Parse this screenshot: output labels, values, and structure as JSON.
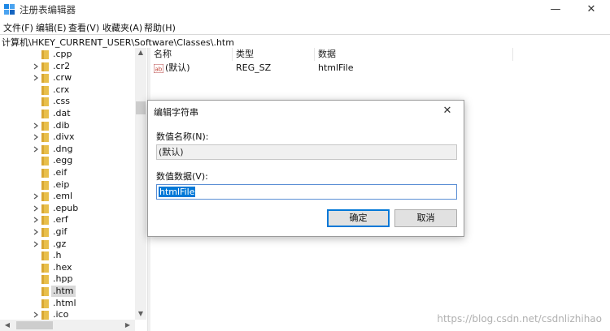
{
  "window": {
    "title": "注册表编辑器",
    "minimize": "—",
    "close": "✕"
  },
  "menu": [
    "文件(F)",
    "编辑(E)",
    "查看(V)",
    "收藏夹(A)",
    "帮助(H)"
  ],
  "address": "计算机\\HKEY_CURRENT_USER\\Software\\Classes\\.htm",
  "tree": [
    {
      "label": ".cpp",
      "expandable": false
    },
    {
      "label": ".cr2",
      "expandable": true
    },
    {
      "label": ".crw",
      "expandable": true
    },
    {
      "label": ".crx",
      "expandable": false
    },
    {
      "label": ".css",
      "expandable": false
    },
    {
      "label": ".dat",
      "expandable": false
    },
    {
      "label": ".dib",
      "expandable": true
    },
    {
      "label": ".divx",
      "expandable": true
    },
    {
      "label": ".dng",
      "expandable": true
    },
    {
      "label": ".egg",
      "expandable": false
    },
    {
      "label": ".eif",
      "expandable": false
    },
    {
      "label": ".eip",
      "expandable": false
    },
    {
      "label": ".eml",
      "expandable": true
    },
    {
      "label": ".epub",
      "expandable": true
    },
    {
      "label": ".erf",
      "expandable": true
    },
    {
      "label": ".gif",
      "expandable": true
    },
    {
      "label": ".gz",
      "expandable": true
    },
    {
      "label": ".h",
      "expandable": false
    },
    {
      "label": ".hex",
      "expandable": false
    },
    {
      "label": ".hpp",
      "expandable": false
    },
    {
      "label": ".htm",
      "expandable": false,
      "selected": true
    },
    {
      "label": ".html",
      "expandable": false
    },
    {
      "label": ".ico",
      "expandable": true
    }
  ],
  "values": {
    "headers": {
      "name": "名称",
      "type": "类型",
      "data": "数据"
    },
    "rows": [
      {
        "name": "(默认)",
        "type": "REG_SZ",
        "data": "htmlFile"
      }
    ]
  },
  "dialog": {
    "title": "编辑字符串",
    "name_label": "数值名称(N):",
    "name_value": "(默认)",
    "data_label": "数值数据(V):",
    "data_value": "htmlFile",
    "ok": "确定",
    "cancel": "取消"
  },
  "watermark": "https://blog.csdn.net/csdnlizhihao",
  "colors": {
    "accent": "#0078d7",
    "folder": "#e8bf4b",
    "selection": "#d9d9d9"
  }
}
